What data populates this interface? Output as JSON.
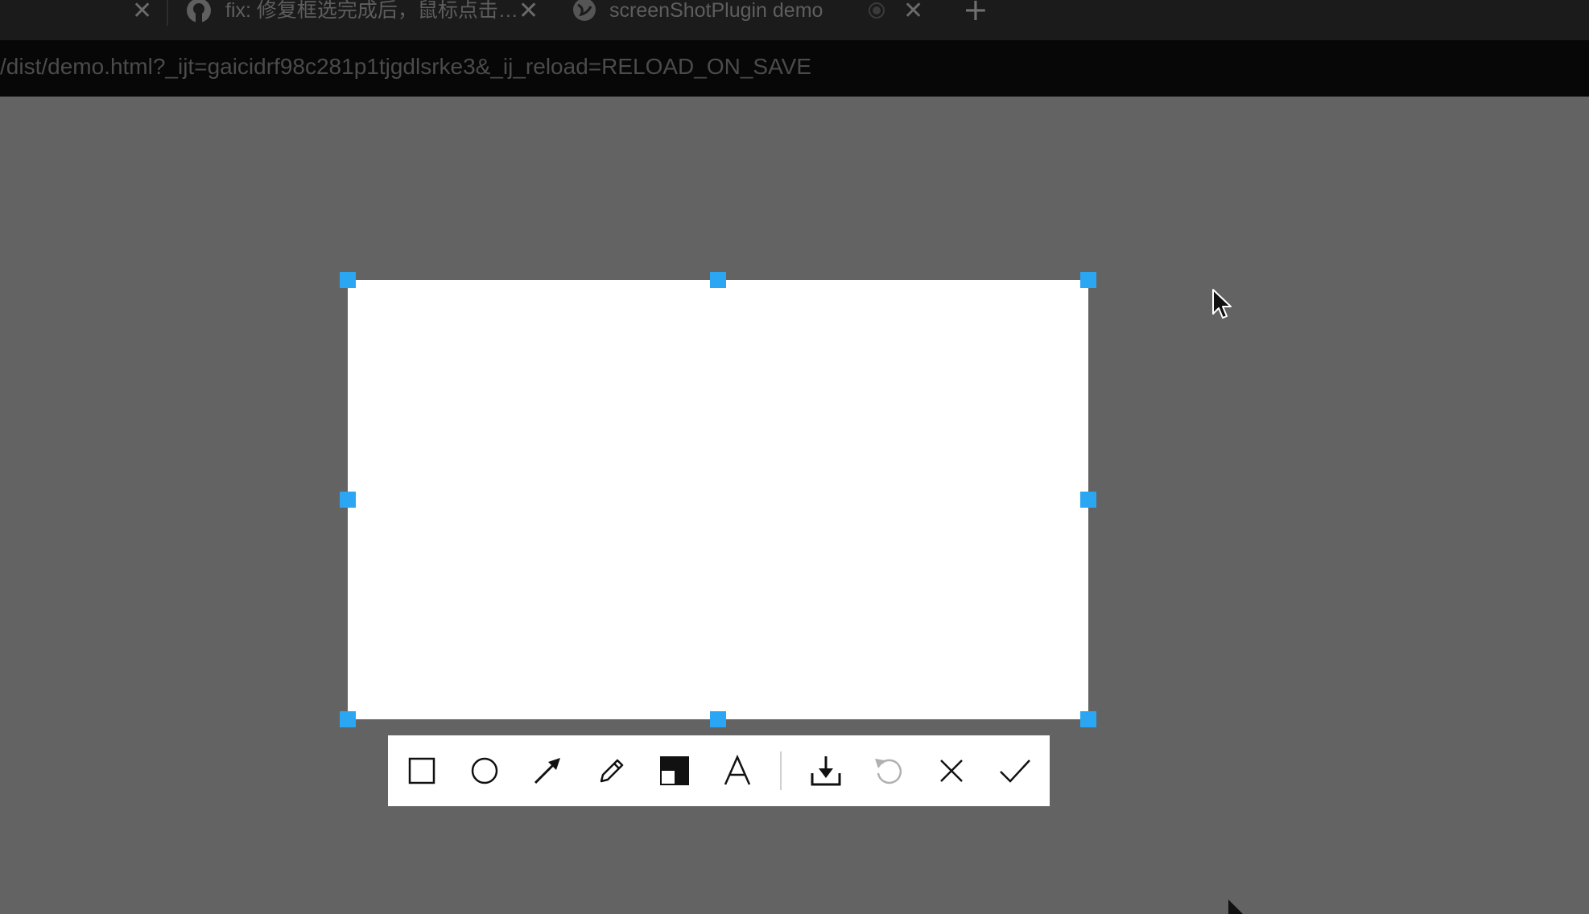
{
  "browser": {
    "tabs": [
      {
        "title": "fix: 修复框选完成后，鼠标点击…",
        "icon": "github-icon"
      },
      {
        "title": "screenShotPlugin demo",
        "icon": "globe-icon"
      }
    ],
    "address_url": "/dist/demo.html?_ijt=gaicidrf98c281p1tjgdlsrke3&_ij_reload=RELOAD_ON_SAVE"
  },
  "selection": {
    "handle_color": "#2aa6f2",
    "fill_color": "#ffffff"
  },
  "toolbar": {
    "tools": [
      "rectangle-icon",
      "circle-icon",
      "arrow-icon",
      "pencil-icon",
      "mosaic-icon",
      "text-icon",
      "download-icon",
      "undo-icon",
      "close-icon",
      "confirm-icon"
    ]
  },
  "colors": {
    "overlay": "#636363",
    "tabbar": "#1b1b1b",
    "addressbar": "#070707"
  }
}
